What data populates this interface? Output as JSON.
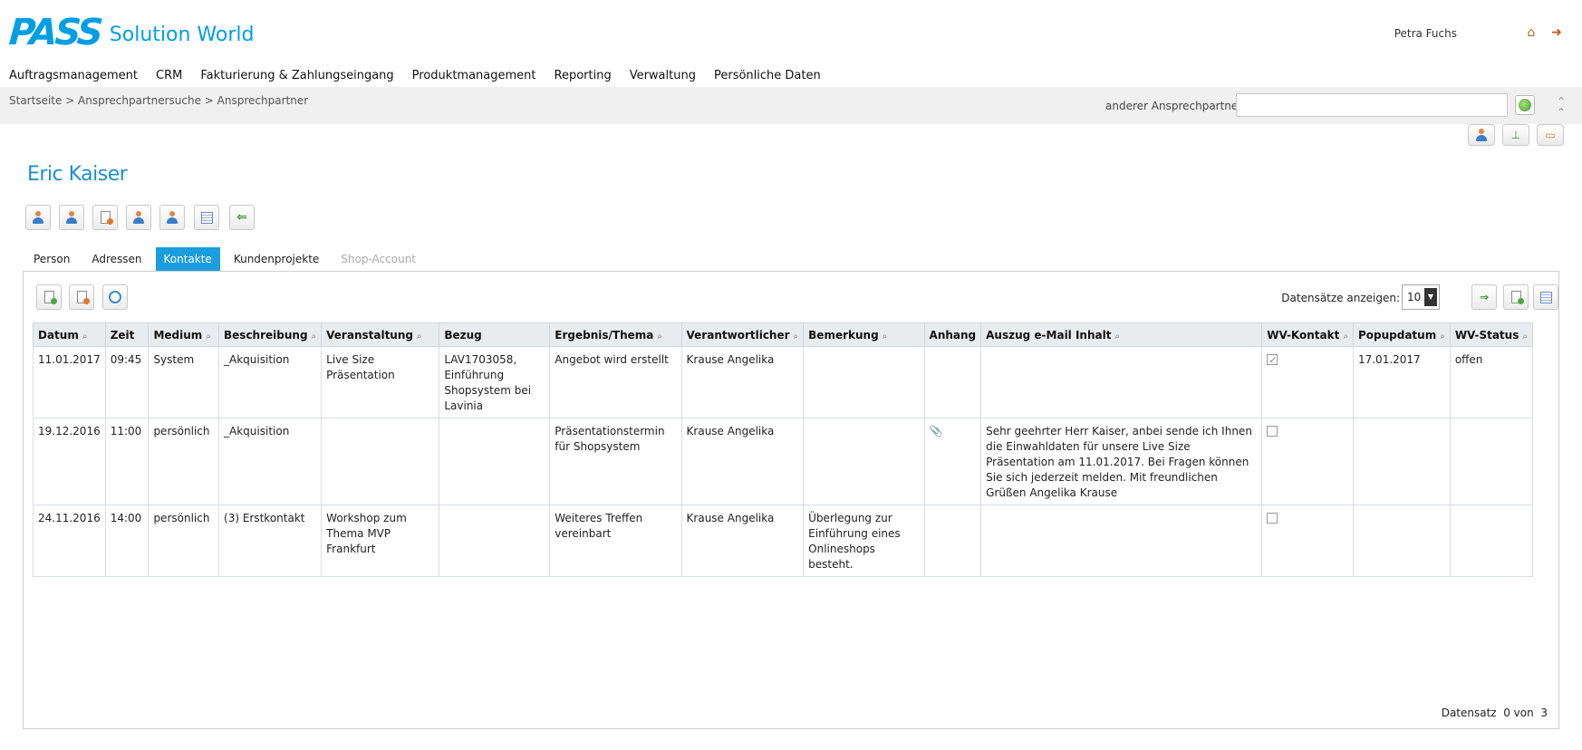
{
  "header": {
    "logo_main": "PASS",
    "logo_sub": "Solution World",
    "user": "Petra Fuchs"
  },
  "nav": [
    "Auftragsmanagement",
    "CRM",
    "Fakturierung & Zahlungseingang",
    "Produktmanagement",
    "Reporting",
    "Verwaltung",
    "Persönliche Daten"
  ],
  "breadcrumb": "Startseite > Ansprechpartnersuche > Ansprechpartner",
  "search": {
    "label": "anderer Ansprechpartner",
    "value": ""
  },
  "person_name": "Eric Kaiser",
  "tabs": [
    {
      "label": "Person",
      "state": "normal"
    },
    {
      "label": "Adressen",
      "state": "normal"
    },
    {
      "label": "Kontakte",
      "state": "active"
    },
    {
      "label": "Kundenprojekte",
      "state": "normal"
    },
    {
      "label": "Shop-Account",
      "state": "disabled"
    }
  ],
  "records": {
    "label": "Datensätze anzeigen:",
    "value": "10"
  },
  "table": {
    "headers": [
      "Datum",
      "Zeit",
      "Medium",
      "Beschreibung",
      "Veranstaltung",
      "Bezug",
      "Ergebnis/Thema",
      "Verantwortlicher",
      "Bemerkung",
      "Anhang",
      "Auszug e-Mail Inhalt",
      "WV-Kontakt",
      "Popupdatum",
      "WV-Status"
    ],
    "rows": [
      [
        "11.01.2017",
        "09:45",
        "System",
        "_Akquisition",
        "Live Size Präsentation",
        "LAV1703058, Einführung Shopsystem bei Lavinia",
        "Angebot wird erstellt",
        "Krause Angelika",
        "",
        "",
        "",
        "",
        "17.01.2017",
        "offen"
      ],
      [
        "19.12.2016",
        "11:00",
        "persönlich",
        "_Akquisition",
        "",
        "",
        "Präsentationstermin für Shopsystem",
        "Krause Angelika",
        "",
        "",
        "Sehr geehrter Herr Kaiser, anbei sende ich Ihnen die Einwahldaten für unsere Live Size Präsentation am 11.01.2017. Bei Fragen können Sie sich jederzeit melden. Mit freundlichen Grüßen Angelika Krause",
        "",
        "",
        ""
      ],
      [
        "24.11.2016",
        "14:00",
        "persönlich",
        "(3) Erstkontakt",
        "Workshop zum Thema MVP Frankfurt",
        "",
        "Weiteres Treffen vereinbart",
        "Krause Angelika",
        "Überlegung zur Einführung eines Onlineshops besteht.",
        "",
        "",
        "",
        "",
        ""
      ]
    ]
  },
  "footer": "Datensatz  0 von  3",
  "colors": {
    "accent": "#1b9ee0",
    "brand": "#009fe3"
  }
}
